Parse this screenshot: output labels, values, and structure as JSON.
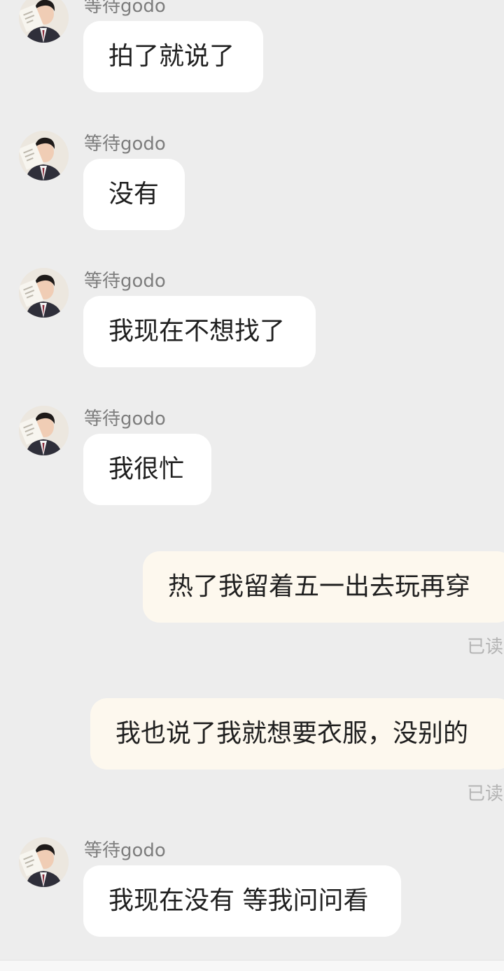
{
  "chat": {
    "sender_name": "等待godo",
    "read_label": "已读",
    "messages": [
      {
        "from": "other",
        "sender": "等待godo",
        "text": "拍了就说了"
      },
      {
        "from": "other",
        "sender": "等待godo",
        "text": "没有"
      },
      {
        "from": "other",
        "sender": "等待godo",
        "text": "我现在不想找了"
      },
      {
        "from": "other",
        "sender": "等待godo",
        "text": "我很忙"
      },
      {
        "from": "me",
        "text": "热了我留着五一出去玩再穿",
        "status": "已读"
      },
      {
        "from": "me",
        "text": "我也说了我就想要衣服，没别的",
        "status": "已读"
      },
      {
        "from": "other",
        "sender": "等待godo",
        "text": "我现在没有 等我问问看"
      }
    ]
  },
  "colors": {
    "background": "#ededed",
    "incoming_bubble": "#ffffff",
    "outgoing_bubble": "#fdf8ee",
    "sender_text": "#7d7d7d",
    "read_text": "#b4b4b4",
    "message_text": "#1f1f1f"
  },
  "icons": {
    "avatar": "avatar-icon"
  }
}
